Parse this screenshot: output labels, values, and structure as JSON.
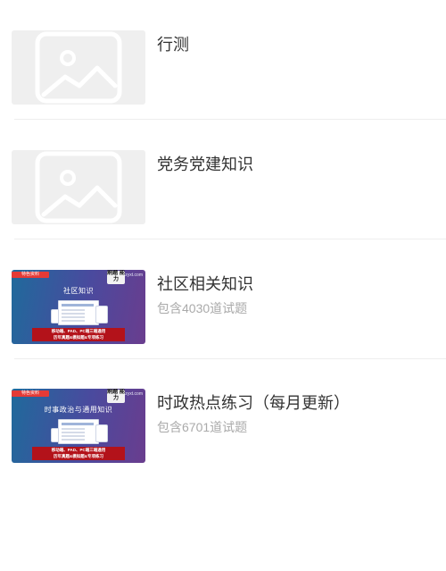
{
  "items": [
    {
      "title": "行测",
      "subtitle": "",
      "thumbnail": "image-placeholder-icon"
    },
    {
      "title": "党务党建知识",
      "subtitle": "",
      "thumbnail": "image-placeholder-icon"
    },
    {
      "title": "社区相关知识",
      "subtitle": "包含4030道试题",
      "thumbnail": "course-cover",
      "cover": {
        "tag": "特色资料",
        "logo": "刷题\n能力",
        "site": "zyxt.com",
        "heading": "社区知识",
        "banner_line1": "移动端、PAD、PC端三端通用",
        "banner_line2": "历年真题&模拟题&专项练习"
      }
    },
    {
      "title": "时政热点练习（每月更新）",
      "subtitle": "包含6701道试题",
      "thumbnail": "course-cover",
      "cover": {
        "tag": "特色资料",
        "logo": "刷题\n能力",
        "site": "zyxt.com",
        "heading": "时事政治与通用知识",
        "banner_line1": "移动端、PAD、PC端三端通用",
        "banner_line2": "历年真题&模拟题&专项练习"
      }
    }
  ],
  "colors": {
    "title": "#333333",
    "subtitle": "#aaaaaa",
    "divider": "#eeeeee",
    "placeholder_bg": "#efefef",
    "cover_tag": "#e43a36",
    "cover_banner": "#b3121a"
  }
}
